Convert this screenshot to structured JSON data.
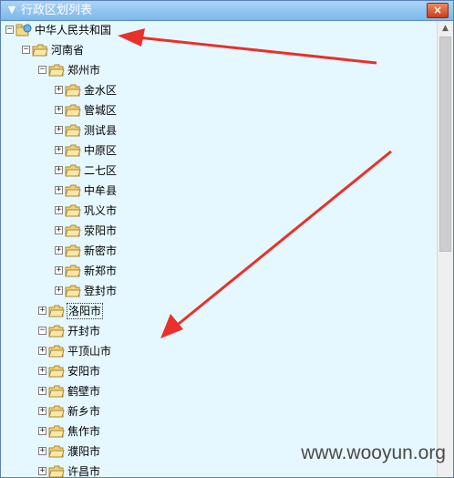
{
  "window": {
    "title": "行政区划列表",
    "close_label": "×"
  },
  "icons": {
    "collapse": "−",
    "expand": "+",
    "title_menu": "chevron-down-icon",
    "root_icon": "globe-folder-icon",
    "node_icon": "folder-icon"
  },
  "tree": {
    "root": "中华人民共和国",
    "province": "河南省",
    "city_expanded": "郑州市",
    "districts": [
      "金水区",
      "管城区",
      "测试县",
      "中原区",
      "二七区",
      "中牟县",
      "巩义市",
      "荥阳市",
      "新密市",
      "新郑市",
      "登封市"
    ],
    "cities": [
      "洛阳市",
      "开封市",
      "平顶山市",
      "安阳市",
      "鹤壁市",
      "新乡市",
      "焦作市",
      "濮阳市",
      "许昌市"
    ],
    "selected_city": "洛阳市"
  },
  "watermark": "www.wooyun.org",
  "colors": {
    "tree_background": "#e6f8ff",
    "titlebar": "#7db8ea",
    "annotation_arrow": "#e8312a"
  }
}
